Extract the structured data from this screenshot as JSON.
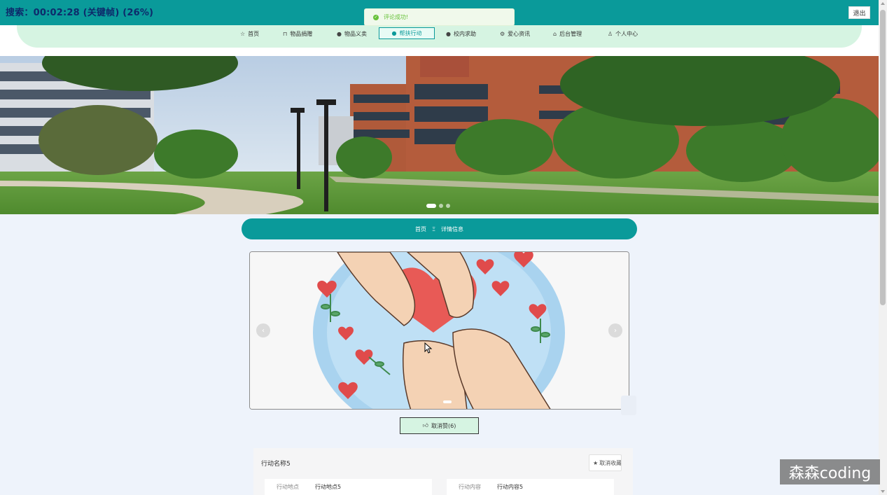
{
  "header": {
    "title": "搜索：00:02:28 (关键帧) (26%)",
    "logout_label": "退出"
  },
  "toast": {
    "message": "评论成功!"
  },
  "nav": {
    "items": [
      {
        "label": "首页",
        "icon": "star-outline-icon"
      },
      {
        "label": "物品捐赠",
        "icon": "bag-icon"
      },
      {
        "label": "物品义卖",
        "icon": "info-icon"
      },
      {
        "label": "帮扶行动",
        "icon": "question-icon"
      },
      {
        "label": "校内求助",
        "icon": "info-icon"
      },
      {
        "label": "爱心资讯",
        "icon": "gear-icon"
      },
      {
        "label": "后台管理",
        "icon": "store-icon"
      },
      {
        "label": "个人中心",
        "icon": "user-icon"
      }
    ],
    "active": "帮扶行动"
  },
  "banner": {
    "slide_count": 3,
    "active_slide": 1
  },
  "breadcrumb": {
    "home": "首页",
    "separator": "Ξ",
    "current": "详情信息"
  },
  "detail": {
    "like_label": "取消赞(6)",
    "title": "行动名称5",
    "fav_label": "取消收藏",
    "fields": [
      {
        "key": "行动地点",
        "value": "行动地点5"
      },
      {
        "key": "行动内容",
        "value": "行动内容5"
      }
    ]
  },
  "watermark": "森森coding",
  "colors": {
    "primary": "#0a9a9a",
    "mint": "#d6f4e2",
    "background": "#eef3fb"
  }
}
